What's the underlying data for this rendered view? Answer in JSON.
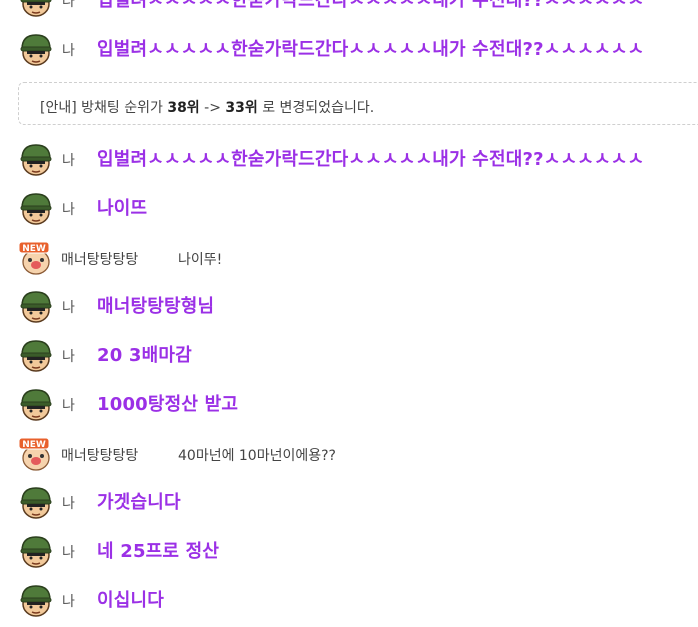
{
  "me_label": "나",
  "messages": [
    {
      "kind": "mine",
      "text": "입벌려ㅅㅅㅅㅅㅅ한숟가락드간다ㅅㅅㅅㅅㅅ내가 수전대??ㅅㅅㅅㅅㅅㅅ"
    },
    {
      "kind": "mine",
      "text": "입벌려ㅅㅅㅅㅅㅅ한숟가락드간다ㅅㅅㅅㅅㅅ내가 수전대??ㅅㅅㅅㅅㅅㅅ"
    },
    {
      "kind": "notice",
      "prefix": "[안내] 방채팅 순위가 ",
      "from": "38위",
      "arrow": " -> ",
      "to": "33위",
      "suffix": " 로 변경되었습니다."
    },
    {
      "kind": "mine",
      "text": "입벌려ㅅㅅㅅㅅㅅ한숟가락드간다ㅅㅅㅅㅅㅅ내가 수전대??ㅅㅅㅅㅅㅅㅅ"
    },
    {
      "kind": "mine",
      "text": "나이뜨"
    },
    {
      "kind": "other",
      "name": "매너탕탕탕탕",
      "text": "나이뚜!"
    },
    {
      "kind": "mine",
      "text": "매너탕탕탕형님"
    },
    {
      "kind": "mine",
      "text": "20 3배마감"
    },
    {
      "kind": "mine",
      "text": "1000탕정산 받고"
    },
    {
      "kind": "other",
      "name": "매너탕탕탕탕",
      "text": "40마넌에 10마넌이에용??"
    },
    {
      "kind": "mine",
      "text": "가겟습니다"
    },
    {
      "kind": "mine",
      "text": "네 25프로 정산"
    },
    {
      "kind": "mine",
      "text": "이십니다"
    }
  ],
  "other_badge": "NEW",
  "colors": {
    "mine_text": "#9b30e6",
    "other_text": "#444444",
    "badge": "#e8602c"
  }
}
